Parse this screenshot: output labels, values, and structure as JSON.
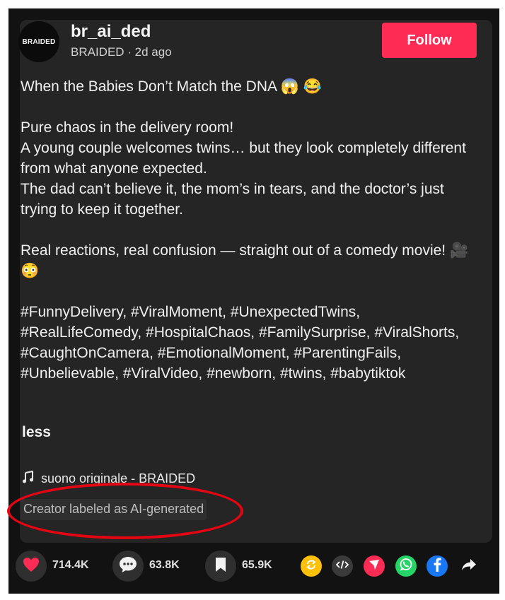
{
  "post": {
    "avatar_text": "BRAIDED",
    "username": "br_ai_ded",
    "author_meta": "BRAIDED · 2d ago",
    "follow_label": "Follow",
    "description": [
      "When the Babies Don’t Match the DNA 😱 😂",
      "Pure chaos in the delivery room!\nA young couple welcomes twins… but they look completely different from what anyone expected.\nThe dad can’t believe it, the mom’s in tears, and the doctor’s just trying to keep it together.",
      "Real reactions, real confusion — straight out of a comedy movie! 🎥 😳",
      "#FunnyDelivery, #ViralMoment, #UnexpectedTwins, #RealLifeComedy, #HospitalChaos, #FamilySurprise, #ViralShorts, #CaughtOnCamera, #EmotionalMoment, #ParentingFails, #Unbelievable, #ViralVideo, #newborn, #twins, #babytiktok"
    ],
    "less_label": "less",
    "sound_label": "suono originale - BRAIDED",
    "ai_label": "Creator labeled as AI-generated"
  },
  "actions": {
    "likes": "714.4K",
    "comments": "63.8K",
    "saves": "65.9K"
  },
  "share_targets": [
    "repost-icon",
    "embed-icon",
    "send-icon",
    "whatsapp-icon",
    "facebook-icon",
    "share-arrow-icon"
  ],
  "colors": {
    "follow_bg": "#fe2c55",
    "like_icon": "#fe2c55",
    "annotation": "#e30612",
    "repost": "#ffc107",
    "send": "#fe2c55",
    "whatsapp": "#25d366",
    "facebook": "#1877f2"
  }
}
